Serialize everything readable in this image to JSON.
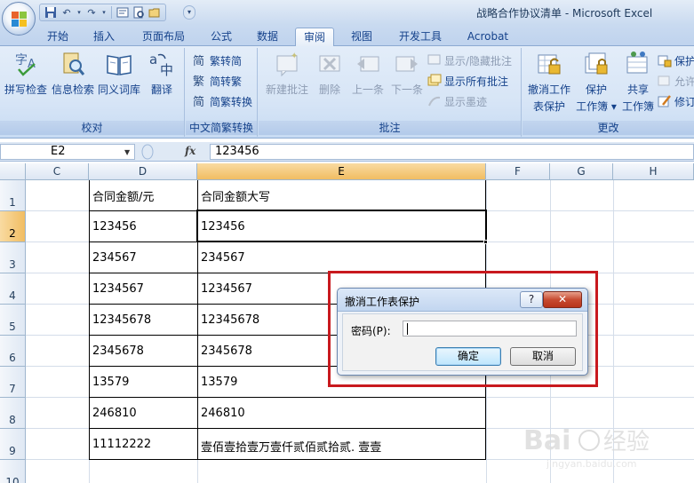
{
  "window": {
    "title": "战略合作协议清单 - Microsoft Excel"
  },
  "tabs": [
    {
      "label": "开始"
    },
    {
      "label": "插入"
    },
    {
      "label": "页面布局"
    },
    {
      "label": "公式"
    },
    {
      "label": "数据"
    },
    {
      "label": "审阅",
      "active": true
    },
    {
      "label": "视图"
    },
    {
      "label": "开发工具"
    },
    {
      "label": "Acrobat"
    }
  ],
  "ribbon": {
    "proofing": {
      "label": "校对",
      "spelling": "拼写检查",
      "research": "信息检索",
      "thesaurus": "同义词库",
      "translate": "翻译"
    },
    "chinese": {
      "label": "中文简繁转换",
      "to_simplified": "繁转简",
      "to_traditional": "简转繁",
      "convert": "简繁转换"
    },
    "comments": {
      "label": "批注",
      "new": "新建批注",
      "delete": "删除",
      "previous": "上一条",
      "next": "下一条",
      "show_hide": "显示/隐藏批注",
      "show_all": "显示所有批注",
      "show_ink": "显示墨迹"
    },
    "changes": {
      "label": "更改",
      "unprotect_sheet_1": "撤消工作",
      "unprotect_sheet_2": "表保护",
      "protect_workbook_1": "保护",
      "protect_workbook_2": "工作簿",
      "share_workbook_1": "共享",
      "share_workbook_2": "工作簿",
      "protect_share": "保护",
      "allow_edit": "允许",
      "track": "修订"
    }
  },
  "formula_bar": {
    "name_box": "E2",
    "fx": "fx",
    "value": "123456"
  },
  "sheet": {
    "columns": [
      "C",
      "D",
      "E",
      "F",
      "G",
      "H"
    ],
    "rows": [
      "1",
      "2",
      "3",
      "4",
      "5",
      "6",
      "7",
      "8",
      "9",
      "10"
    ],
    "header": {
      "d": "合同金额/元",
      "e": "合同金额大写"
    },
    "data": [
      {
        "d": "123456",
        "e": "123456"
      },
      {
        "d": "234567",
        "e": "234567"
      },
      {
        "d": "1234567",
        "e": "1234567"
      },
      {
        "d": "12345678",
        "e": "12345678"
      },
      {
        "d": "2345678",
        "e": "2345678"
      },
      {
        "d": "13579",
        "e": "13579"
      },
      {
        "d": "246810",
        "e": "246810"
      },
      {
        "d": "11112222",
        "e": "壹佰壹拾壹万壹仟贰佰贰拾贰. 壹壹"
      }
    ]
  },
  "dialog": {
    "title": "撤消工作表保护",
    "help": "?",
    "close": "✕",
    "password_label": "密码(P):",
    "password_value": "",
    "ok": "确定",
    "cancel": "取消"
  }
}
